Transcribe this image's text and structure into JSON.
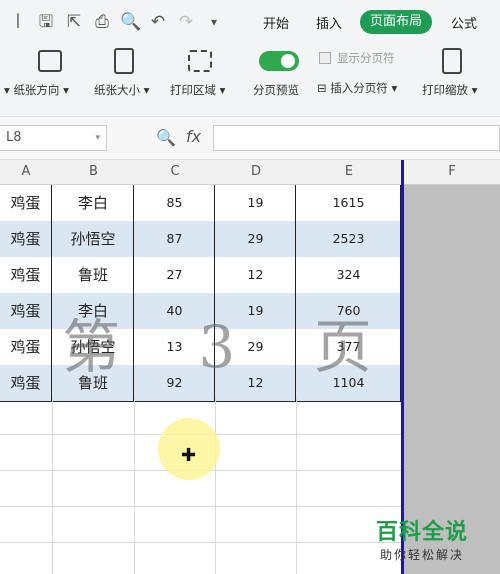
{
  "tabs": [
    "开始",
    "插入",
    "页面布局",
    "公式"
  ],
  "ribbon": {
    "orientation": "纸张方向",
    "size": "纸张大小",
    "print_area": "打印区域",
    "page_preview": "分页预览",
    "show_page_break": "显示分页符",
    "insert_page_break": "插入分页符",
    "print_scale": "打印缩放"
  },
  "formula_bar": {
    "cell_ref": "L8",
    "fx": "fx"
  },
  "columns": [
    "A",
    "B",
    "C",
    "D",
    "E",
    "F"
  ],
  "rows": [
    [
      "鸡蛋",
      "李白",
      "85",
      "19",
      "1615"
    ],
    [
      "鸡蛋",
      "孙悟空",
      "87",
      "29",
      "2523"
    ],
    [
      "鸡蛋",
      "鲁班",
      "27",
      "12",
      "324"
    ],
    [
      "鸡蛋",
      "李白",
      "40",
      "19",
      "760"
    ],
    [
      "鸡蛋",
      "孙悟空",
      "13",
      "29",
      "377"
    ],
    [
      "鸡蛋",
      "鲁班",
      "92",
      "12",
      "1104"
    ]
  ],
  "watermark": "第 3 页",
  "logo": {
    "main": "百科全说",
    "sub": "助你轻松解决"
  },
  "colors": {
    "accent": "#1f9d55",
    "row_alt": "#dbe6f3",
    "page_border": "#1a1aa6"
  }
}
